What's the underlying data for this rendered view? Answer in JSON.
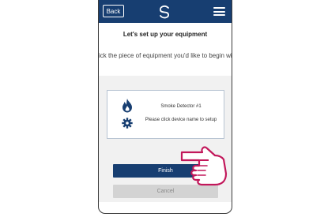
{
  "header": {
    "back_label": "Back",
    "logo_icon": "swirl-logo-icon",
    "menu_icon": "hamburger-menu-icon"
  },
  "page": {
    "title": "Let's set up your equipment",
    "subtitle": "Click the piece of equipment you'd like to begin with."
  },
  "device": {
    "icons": [
      "flame-icon",
      "gear-icon"
    ],
    "name": "Smoke Detector #1",
    "hint": "Please click device name to setup"
  },
  "actions": {
    "finish_label": "Finish",
    "cancel_label": "Cancel"
  },
  "colors": {
    "brand": "#173e71",
    "cursor_hand": "#c2185b",
    "panel": "#f1f1f1",
    "cancel_bg": "#d3d3d3"
  },
  "overlay": {
    "pointer_icon": "pointing-hand-icon"
  }
}
